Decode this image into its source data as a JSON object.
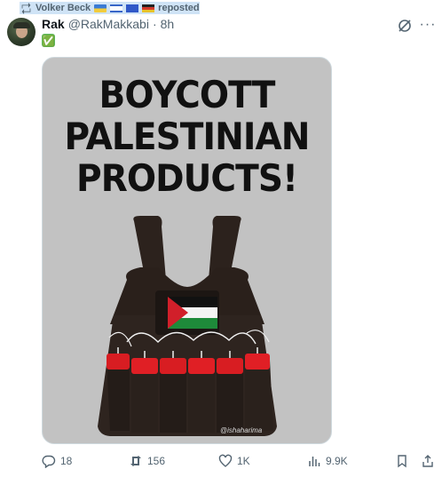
{
  "repost": {
    "user": "Volker Beck",
    "label": "reposted"
  },
  "tweet": {
    "name": "Rak",
    "handle": "@RakMakkabi",
    "separator": "·",
    "time": "8h",
    "text_emoji": "✅"
  },
  "media": {
    "headline": [
      "BOYCOTT",
      "PALESTINIAN",
      "PRODUCTS!"
    ],
    "watermark": "@ishaharima"
  },
  "actions": {
    "replies": "18",
    "reposts": "156",
    "likes": "1K",
    "views": "9.9K"
  }
}
